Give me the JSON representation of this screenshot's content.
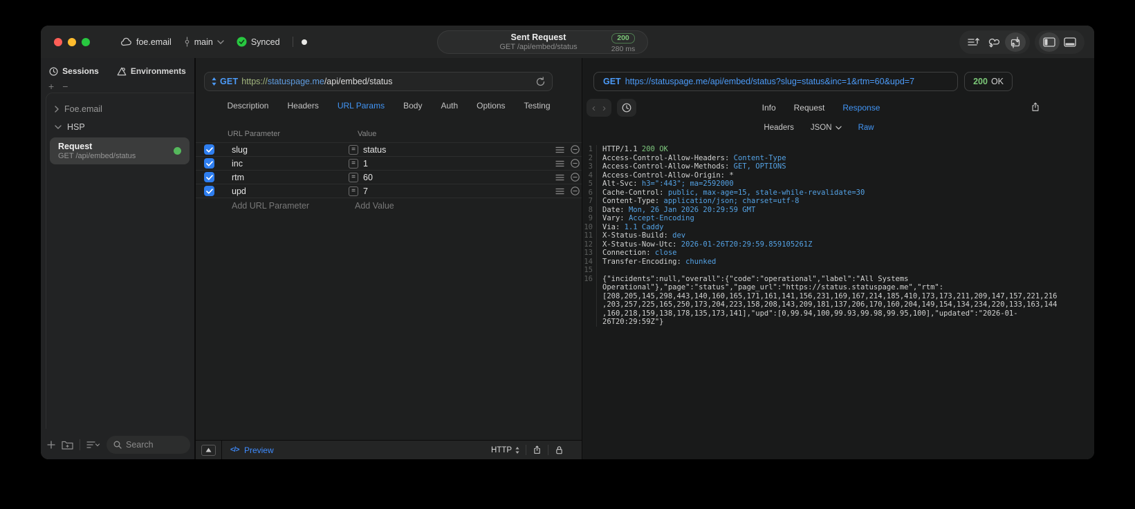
{
  "titlebar": {
    "project_name": "foe.email",
    "branch_name": "main",
    "sync_label": "Synced",
    "request_summary": {
      "title": "Sent Request",
      "subtitle": "GET /api/embed/status",
      "status_code": "200",
      "duration": "280 ms"
    }
  },
  "sidebar": {
    "tabs": [
      {
        "label": "Sessions"
      },
      {
        "label": "Environments"
      }
    ],
    "tree": [
      {
        "label": "Foe.email",
        "expanded": false
      },
      {
        "label": "HSP",
        "expanded": true
      }
    ],
    "request_item": {
      "title": "Request",
      "subtitle": "GET /api/embed/status"
    },
    "search_placeholder": "Search"
  },
  "request_pane": {
    "method": "GET",
    "url": {
      "scheme": "https://",
      "host": "statuspage.me",
      "path": "/api/embed/status"
    },
    "tabs": [
      {
        "label": "Description",
        "active": false
      },
      {
        "label": "Headers",
        "active": false
      },
      {
        "label": "URL Params",
        "active": true
      },
      {
        "label": "Body",
        "active": false
      },
      {
        "label": "Auth",
        "active": false
      },
      {
        "label": "Options",
        "active": false
      },
      {
        "label": "Testing",
        "active": false
      }
    ],
    "params": {
      "columns": [
        "URL Parameter",
        "Value"
      ],
      "rows": [
        {
          "name": "slug",
          "value": "status",
          "enabled": true
        },
        {
          "name": "inc",
          "value": "1",
          "enabled": true
        },
        {
          "name": "rtm",
          "value": "60",
          "enabled": true
        },
        {
          "name": "upd",
          "value": "7",
          "enabled": true
        }
      ],
      "add_name_placeholder": "Add URL Parameter",
      "add_value_placeholder": "Add Value"
    },
    "bottom_bar": {
      "code_glyph": "</>",
      "preview_label": "Preview",
      "protocol_label": "HTTP"
    }
  },
  "response_pane": {
    "request_line": {
      "method": "GET",
      "url": "https://statuspage.me/api/embed/status?slug=status&inc=1&rtm=60&upd=7"
    },
    "status": {
      "code": "200",
      "text": "OK"
    },
    "tabs": [
      {
        "label": "Info",
        "active": false
      },
      {
        "label": "Request",
        "active": false
      },
      {
        "label": "Response",
        "active": true
      }
    ],
    "subtabs": [
      {
        "label": "Headers",
        "active": false,
        "dropdown": false
      },
      {
        "label": "JSON",
        "active": false,
        "dropdown": true
      },
      {
        "label": "Raw",
        "active": true,
        "dropdown": false
      }
    ],
    "code": {
      "status_line": {
        "num": 1,
        "protocol": "HTTP/1.1",
        "status": "200 OK"
      },
      "headers": [
        {
          "num": 2,
          "name": "Access-Control-Allow-Headers",
          "value": "Content-Type"
        },
        {
          "num": 3,
          "name": "Access-Control-Allow-Methods",
          "value": "GET, OPTIONS"
        },
        {
          "num": 4,
          "name": "Access-Control-Allow-Origin",
          "value": "*",
          "plain": true
        },
        {
          "num": 5,
          "name": "Alt-Svc",
          "value": "h3=\":443\"; ma=2592000"
        },
        {
          "num": 6,
          "name": "Cache-Control",
          "value": "public, max-age=15, stale-while-revalidate=30"
        },
        {
          "num": 7,
          "name": "Content-Type",
          "value": "application/json; charset=utf-8"
        },
        {
          "num": 8,
          "name": "Date",
          "value": "Mon, 26 Jan 2026 20:29:59 GMT"
        },
        {
          "num": 9,
          "name": "Vary",
          "value": "Accept-Encoding"
        },
        {
          "num": 10,
          "name": "Via",
          "value": "1.1 Caddy"
        },
        {
          "num": 11,
          "name": "X-Status-Build",
          "value": "dev"
        },
        {
          "num": 12,
          "name": "X-Status-Now-Utc",
          "value": "2026-01-26T20:29:59.859105261Z"
        },
        {
          "num": 13,
          "name": "Connection",
          "value": "close"
        },
        {
          "num": 14,
          "name": "Transfer-Encoding",
          "value": "chunked"
        }
      ],
      "blank_line_num": 15,
      "body_line_num": 16,
      "body": "{\"incidents\":null,\"overall\":{\"code\":\"operational\",\"label\":\"All Systems Operational\"},\"page\":\"status\",\"page_url\":\"https://status.statuspage.me\",\"rtm\":[208,205,145,298,443,140,160,165,171,161,141,156,231,169,167,214,185,410,173,173,211,209,147,157,221,216,203,257,225,165,250,173,204,223,158,208,143,209,181,137,206,170,160,204,149,154,134,234,220,133,163,144,160,218,159,138,178,135,173,141],\"upd\":[0,99.94,100,99.93,99.98,99.95,100],\"updated\":\"2026-01-26T20:29:59Z\"}"
    }
  },
  "glyphs": {
    "equals": "=",
    "code": "</>"
  },
  "colors": {
    "accent_blue": "#4296f7",
    "url_blue": "#4c9bf8",
    "value_blue": "#54a2e4",
    "status_green": "#7cc878",
    "sync_green": "#28c840",
    "checkbox_blue": "#2e7ef0"
  }
}
